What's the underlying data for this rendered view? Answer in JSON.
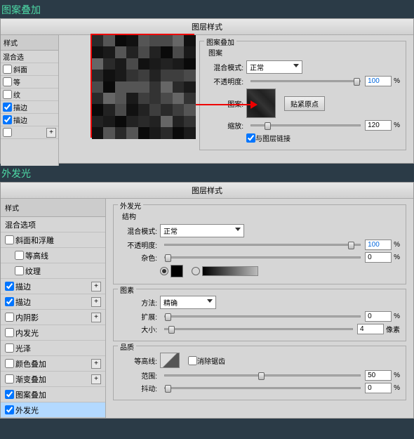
{
  "section1": {
    "label": "图案叠加"
  },
  "section2": {
    "label": "外发光"
  },
  "panel_title": "图层样式",
  "stylelist1": {
    "header": "样式",
    "blend_opt": "混合选",
    "items": [
      "斜面",
      "等",
      "纹",
      "描边",
      "描边"
    ]
  },
  "pattern_overlay": {
    "group": "图案叠加",
    "sub": "图案",
    "blend_mode_lbl": "混合模式:",
    "blend_mode_val": "正常",
    "opacity_lbl": "不透明度:",
    "opacity_val": "100",
    "pattern_lbl": "图案:",
    "snap_btn": "贴紧原点",
    "scale_lbl": "缩放:",
    "scale_val": "120",
    "link_lbl": "与图层链接"
  },
  "stylelist2": {
    "header": "样式",
    "blend_opt": "混合选项",
    "items": [
      {
        "label": "斜面和浮雕",
        "checked": false
      },
      {
        "label": "等高线",
        "checked": false,
        "indent": true
      },
      {
        "label": "纹理",
        "checked": false,
        "indent": true
      },
      {
        "label": "描边",
        "checked": true,
        "plus": true
      },
      {
        "label": "描边",
        "checked": true,
        "plus": true
      },
      {
        "label": "内阴影",
        "checked": false,
        "plus": true
      },
      {
        "label": "内发光",
        "checked": false
      },
      {
        "label": "光泽",
        "checked": false
      },
      {
        "label": "颜色叠加",
        "checked": false,
        "plus": true
      },
      {
        "label": "渐变叠加",
        "checked": false,
        "plus": true
      },
      {
        "label": "图案叠加",
        "checked": true
      },
      {
        "label": "外发光",
        "checked": true,
        "selected": true
      }
    ]
  },
  "outer_glow": {
    "group": "外发光",
    "struct": "结构",
    "blend_mode_lbl": "混合模式:",
    "blend_mode_val": "正常",
    "opacity_lbl": "不透明度:",
    "opacity_val": "100",
    "noise_lbl": "杂色:",
    "noise_val": "0",
    "elements": "图素",
    "method_lbl": "方法:",
    "method_val": "精确",
    "spread_lbl": "扩展:",
    "spread_val": "0",
    "size_lbl": "大小:",
    "size_val": "4",
    "size_unit": "像素",
    "quality": "品质",
    "contour_lbl": "等高线:",
    "antialias_lbl": "消除锯齿",
    "range_lbl": "范围:",
    "range_val": "50",
    "jitter_lbl": "抖动:",
    "jitter_val": "0"
  },
  "pct": "%"
}
